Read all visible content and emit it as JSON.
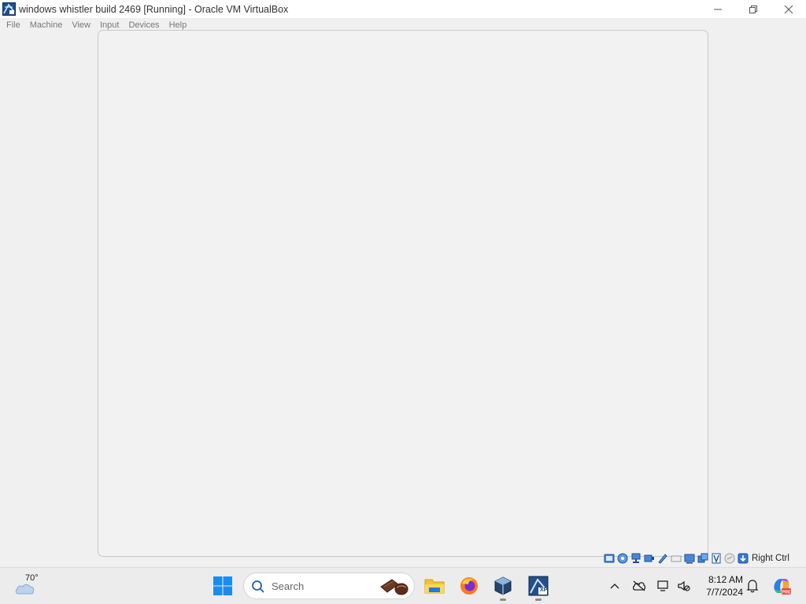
{
  "window": {
    "title": "windows whistler build 2469 [Running] - Oracle VM VirtualBox",
    "controls": [
      "minimize",
      "maximize",
      "close"
    ]
  },
  "menu": {
    "items": [
      "File",
      "Machine",
      "View",
      "Input",
      "Devices",
      "Help"
    ]
  },
  "status_bar": {
    "icons": [
      "hard-disk-icon",
      "optical-drive-icon",
      "network-icon",
      "usb-icon",
      "shared-folders-icon",
      "display-icon",
      "video-capture-icon",
      "cpu-icon",
      "mouse-integration-icon",
      "keyboard-icon"
    ],
    "host_key": "Right Ctrl"
  },
  "taskbar": {
    "weather": {
      "temperature": "70°"
    },
    "search": {
      "placeholder": "Search"
    },
    "apps": [
      "file-explorer-icon",
      "firefox-icon",
      "virtualbox-icon",
      "vm-window-icon"
    ],
    "vm_window_badge": "XP",
    "clock": {
      "time": "8:12 AM",
      "date": "7/7/2024"
    }
  }
}
